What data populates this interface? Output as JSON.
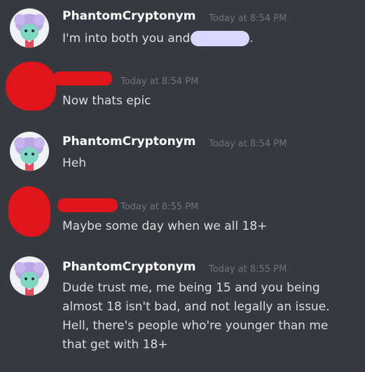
{
  "messages": [
    {
      "username": "PhantomCryptonym",
      "timestamp": "Today at 8:54 PM",
      "lines": [
        "I'm into both you and"
      ],
      "tail": "."
    },
    {
      "username": "",
      "timestamp": "Today at 8:54 PM",
      "lines": [
        "Now thats epic"
      ]
    },
    {
      "username": "PhantomCryptonym",
      "timestamp": "Today at 8:54 PM",
      "lines": [
        "Heh"
      ]
    },
    {
      "username": "",
      "timestamp": "Today at 8:55 PM",
      "lines": [
        "Maybe some day when we all 18+"
      ]
    },
    {
      "username": "PhantomCryptonym",
      "timestamp": "Today at 8:55 PM",
      "lines": [
        "Dude trust me, me being 15 and you being",
        "almost 18 isn't bad, and not legally an issue.",
        "Hell, there's people who're younger than me",
        "that get with 18+"
      ]
    }
  ],
  "colors": {
    "background": "#36393f",
    "username": "#ffffff",
    "text": "#dcddde",
    "timestamp": "#6f7378",
    "redaction": "#e0141b",
    "mention_redaction": "#d9d7fb"
  },
  "icons": {
    "phantom_avatar": "pastel-character-avatar-icon",
    "redacted_avatar": "redacted-avatar-icon"
  }
}
